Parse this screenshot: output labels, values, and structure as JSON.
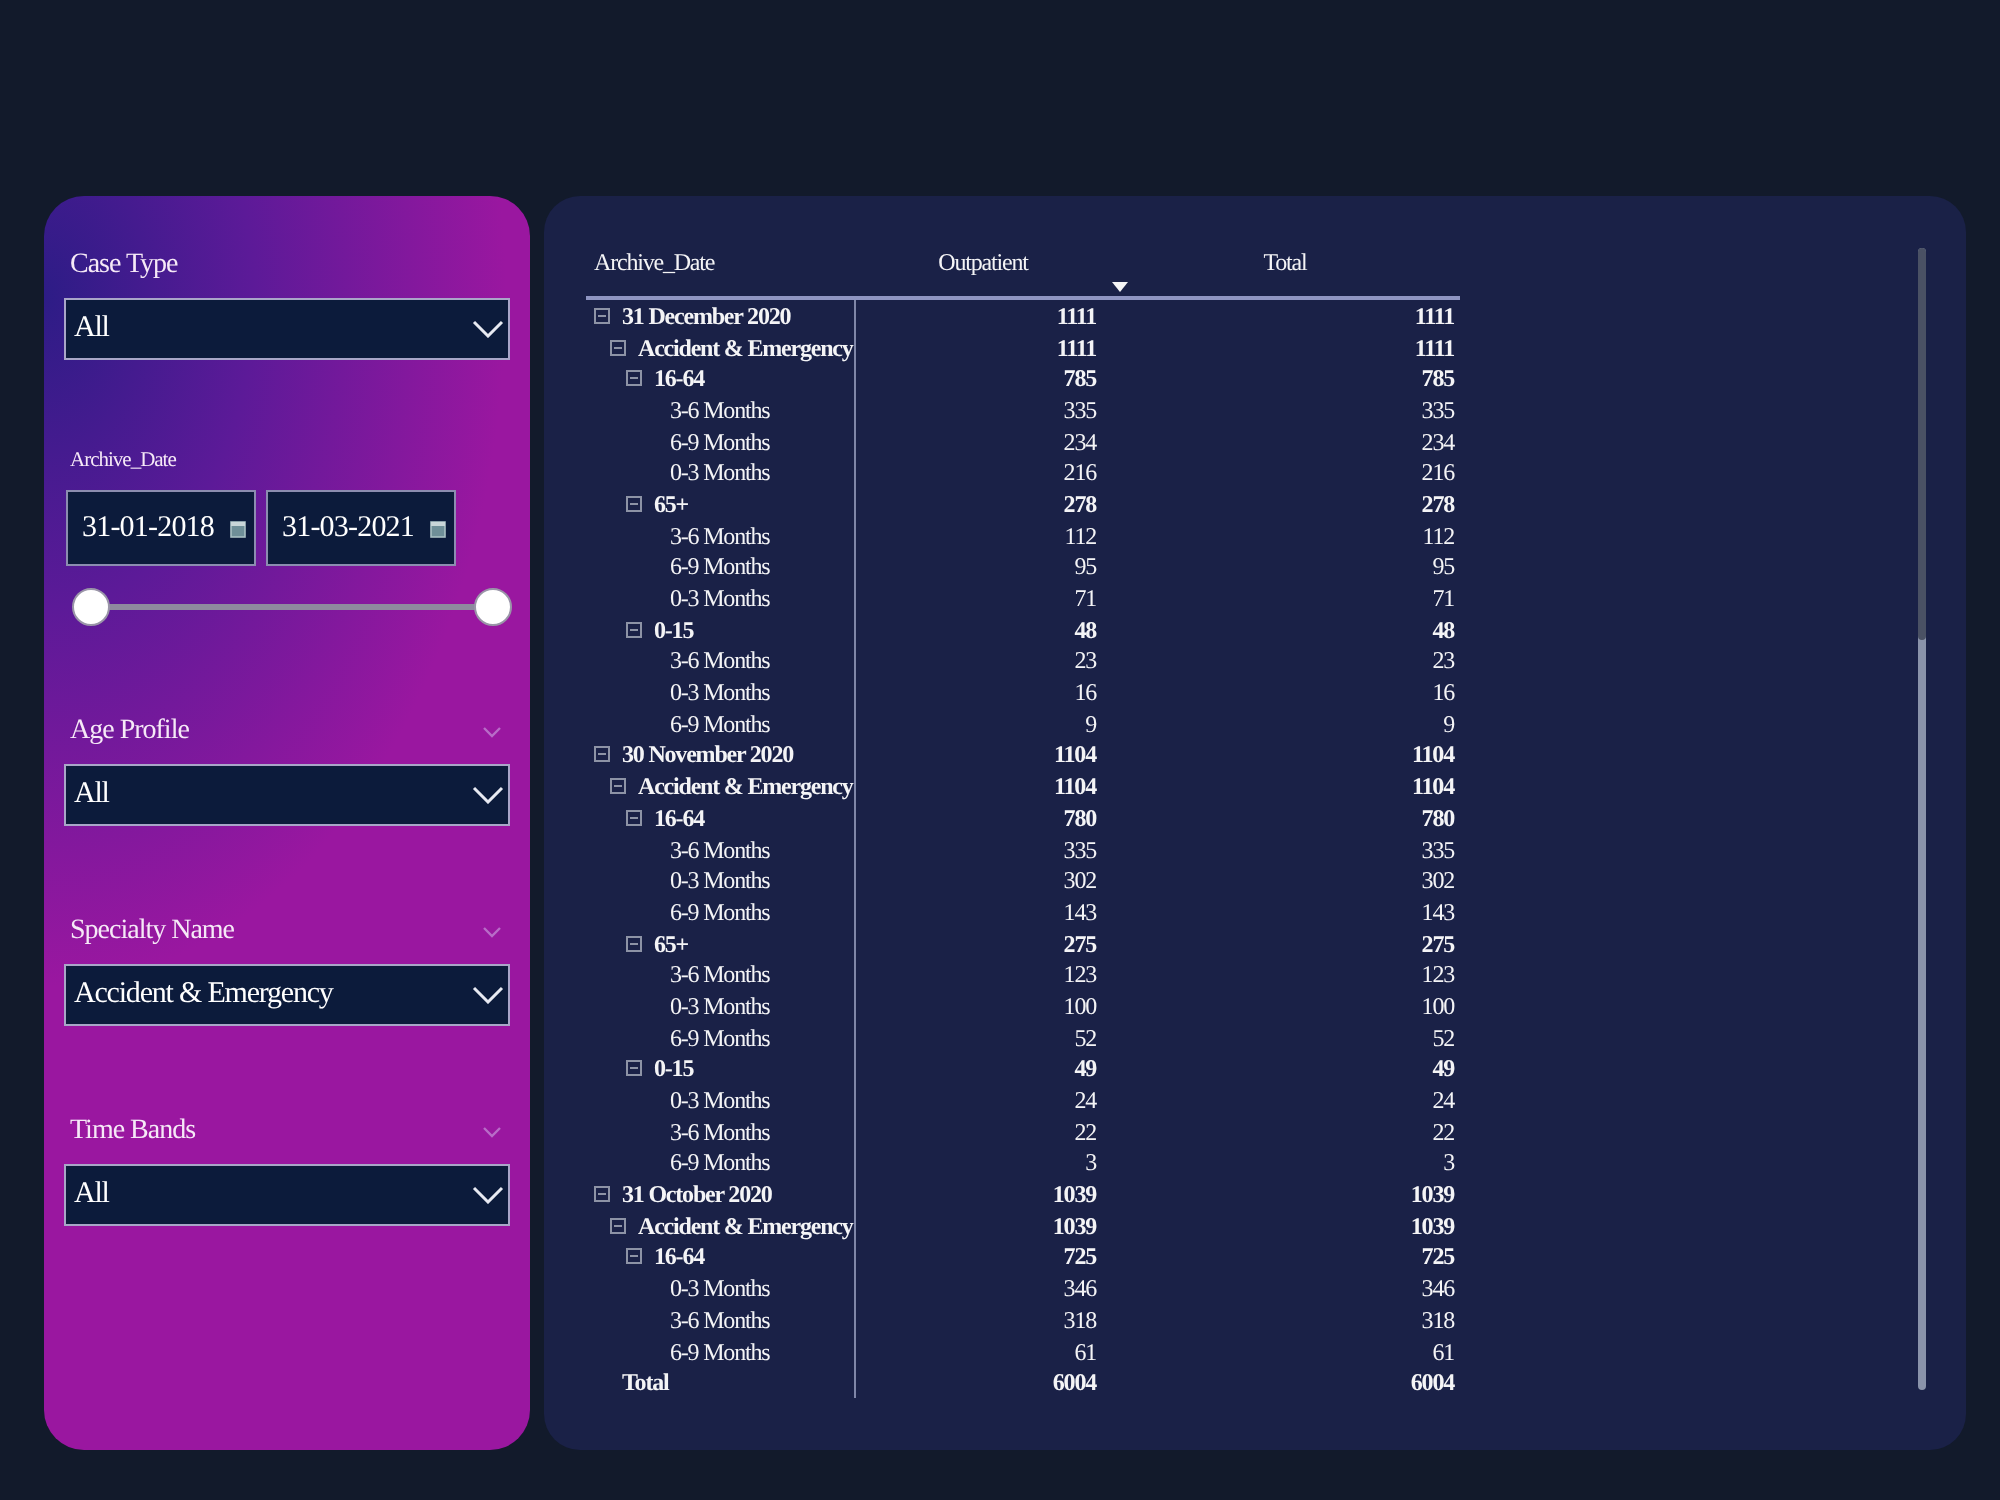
{
  "filters": [
    {
      "kind": "dropdown",
      "label": "Case Type",
      "value": "All",
      "header_chevron": false
    },
    {
      "kind": "date_range",
      "label": "Archive_Date",
      "start": "31-01-2018",
      "end": "31-03-2021",
      "slider": {
        "start": {
          "level": 0
        },
        "end": {
          "level": 1
        }
      }
    },
    {
      "kind": "dropdown",
      "label": "Age Profile",
      "value": "All",
      "header_chevron": true
    },
    {
      "kind": "dropdown",
      "label": "Specialty Name",
      "value": "Accident & Emergency",
      "header_chevron": true
    },
    {
      "kind": "dropdown",
      "label": "Time Bands",
      "value": "All",
      "header_chevron": true
    }
  ],
  "table": {
    "columns": [
      {
        "label": "Archive_Date",
        "sorted": false
      },
      {
        "label": "Outpatient",
        "sorted": true
      },
      {
        "label": "Total",
        "sorted": false
      }
    ],
    "rows": [
      {
        "label": "31 December 2020",
        "values": [
          "1111",
          "1111"
        ],
        "expanded": true,
        "children": [
          {
            "label": "Accident & Emergency",
            "values": [
              "1111",
              "1111"
            ],
            "expanded": true,
            "children": [
              {
                "label": "16-64",
                "values": [
                  "785",
                  "785"
                ],
                "expanded": true,
                "children": [
                  {
                    "label": "3-6 Months",
                    "values": [
                      "335",
                      "335"
                    ]
                  },
                  {
                    "label": "6-9 Months",
                    "values": [
                      "234",
                      "234"
                    ]
                  },
                  {
                    "label": "0-3 Months",
                    "values": [
                      "216",
                      "216"
                    ]
                  }
                ]
              },
              {
                "label": "65+",
                "values": [
                  "278",
                  "278"
                ],
                "expanded": true,
                "children": [
                  {
                    "label": "3-6 Months",
                    "values": [
                      "112",
                      "112"
                    ]
                  },
                  {
                    "label": "6-9 Months",
                    "values": [
                      "95",
                      "95"
                    ]
                  },
                  {
                    "label": "0-3 Months",
                    "values": [
                      "71",
                      "71"
                    ]
                  }
                ]
              },
              {
                "label": "0-15",
                "values": [
                  "48",
                  "48"
                ],
                "expanded": true,
                "children": [
                  {
                    "label": "3-6 Months",
                    "values": [
                      "23",
                      "23"
                    ]
                  },
                  {
                    "label": "0-3 Months",
                    "values": [
                      "16",
                      "16"
                    ]
                  },
                  {
                    "label": "6-9 Months",
                    "values": [
                      "9",
                      "9"
                    ]
                  }
                ]
              }
            ]
          }
        ]
      },
      {
        "label": "30 November 2020",
        "values": [
          "1104",
          "1104"
        ],
        "expanded": true,
        "children": [
          {
            "label": "Accident & Emergency",
            "values": [
              "1104",
              "1104"
            ],
            "expanded": true,
            "children": [
              {
                "label": "16-64",
                "values": [
                  "780",
                  "780"
                ],
                "expanded": true,
                "children": [
                  {
                    "label": "3-6 Months",
                    "values": [
                      "335",
                      "335"
                    ]
                  },
                  {
                    "label": "0-3 Months",
                    "values": [
                      "302",
                      "302"
                    ]
                  },
                  {
                    "label": "6-9 Months",
                    "values": [
                      "143",
                      "143"
                    ]
                  }
                ]
              },
              {
                "label": "65+",
                "values": [
                  "275",
                  "275"
                ],
                "expanded": true,
                "children": [
                  {
                    "label": "3-6 Months",
                    "values": [
                      "123",
                      "123"
                    ]
                  },
                  {
                    "label": "0-3 Months",
                    "values": [
                      "100",
                      "100"
                    ]
                  },
                  {
                    "label": "6-9 Months",
                    "values": [
                      "52",
                      "52"
                    ]
                  }
                ]
              },
              {
                "label": "0-15",
                "values": [
                  "49",
                  "49"
                ],
                "expanded": true,
                "children": [
                  {
                    "label": "0-3 Months",
                    "values": [
                      "24",
                      "24"
                    ]
                  },
                  {
                    "label": "3-6 Months",
                    "values": [
                      "22",
                      "22"
                    ]
                  },
                  {
                    "label": "6-9 Months",
                    "values": [
                      "3",
                      "3"
                    ]
                  }
                ]
              }
            ]
          }
        ]
      },
      {
        "label": "31 October 2020",
        "values": [
          "1039",
          "1039"
        ],
        "expanded": true,
        "children": [
          {
            "label": "Accident & Emergency",
            "values": [
              "1039",
              "1039"
            ],
            "expanded": true,
            "children": [
              {
                "label": "16-64",
                "values": [
                  "725",
                  "725"
                ],
                "expanded": true,
                "children": [
                  {
                    "label": "0-3 Months",
                    "values": [
                      "346",
                      "346"
                    ]
                  },
                  {
                    "label": "3-6 Months",
                    "values": [
                      "318",
                      "318"
                    ]
                  },
                  {
                    "label": "6-9 Months",
                    "values": [
                      "61",
                      "61"
                    ]
                  }
                ]
              }
            ]
          }
        ]
      }
    ],
    "total": {
      "label": "Total",
      "values": [
        "6004",
        "6004"
      ]
    }
  }
}
